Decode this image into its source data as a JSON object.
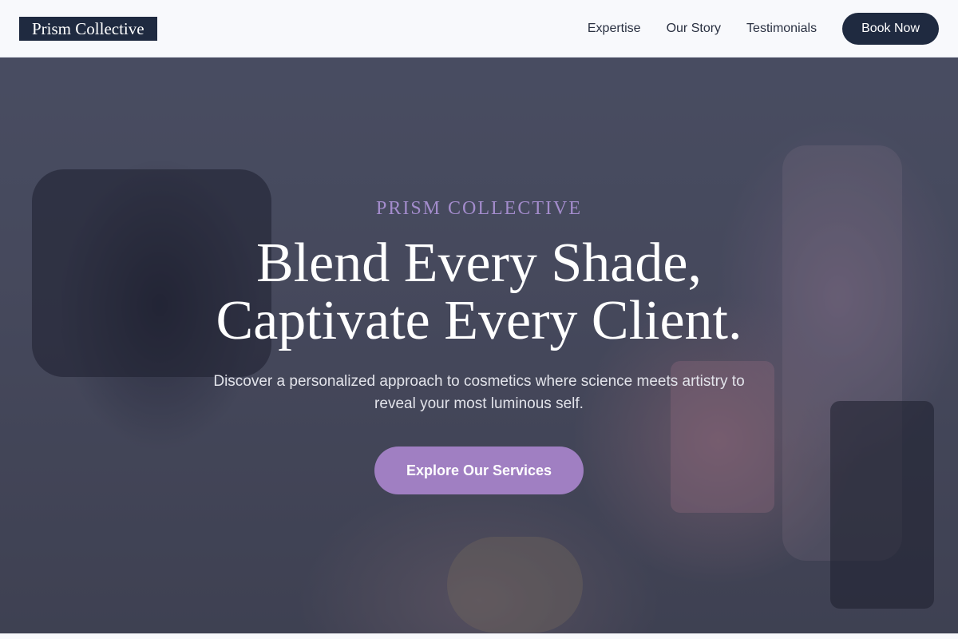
{
  "header": {
    "logo_text": "Prism Collective",
    "nav": [
      {
        "label": "Expertise"
      },
      {
        "label": "Our Story"
      },
      {
        "label": "Testimonials"
      }
    ],
    "cta_label": "Book Now"
  },
  "hero": {
    "eyebrow": "PRISM COLLECTIVE",
    "headline_line1": "Blend Every Shade,",
    "headline_line2": "Captivate Every Client.",
    "subtext": "Discover a personalized approach to cosmetics where science meets artistry to reveal your most luminous self.",
    "cta_label": "Explore Our Services"
  },
  "colors": {
    "brand_dark": "#1f2a40",
    "accent_purple": "#a07fc2",
    "eyebrow_purple": "#a38ccc"
  }
}
